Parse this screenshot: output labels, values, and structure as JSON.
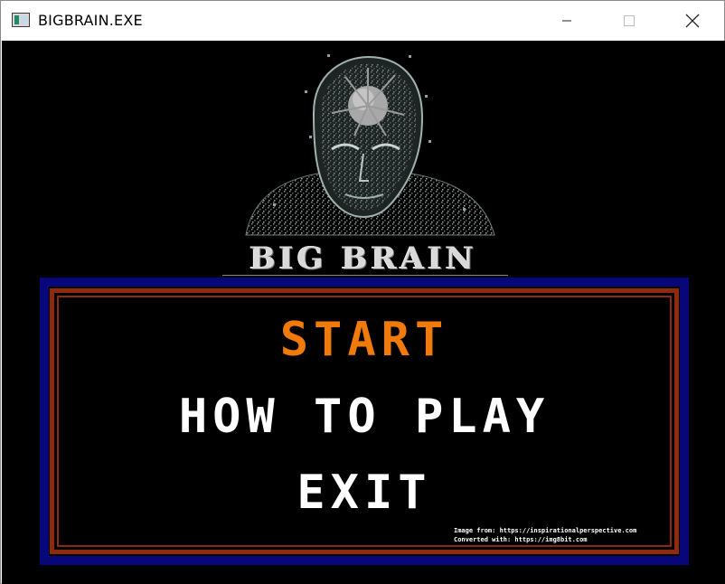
{
  "window": {
    "title": "BIGBRAIN.EXE",
    "app_icon": "app-window-icon",
    "controls": [
      "minimize-icon",
      "maximize-icon",
      "close-icon"
    ]
  },
  "game": {
    "background_color": "#000000",
    "logo_text": "BIG BRAIN",
    "menu": {
      "items": [
        {
          "label": "START",
          "selected": true,
          "color": "#f07a0a"
        },
        {
          "label": "HOW TO PLAY",
          "selected": false,
          "color": "#ffffff"
        },
        {
          "label": "EXIT",
          "selected": false,
          "color": "#ffffff"
        }
      ],
      "border_colors": {
        "outer": "#07077a",
        "inner": "#8e2a0d"
      }
    },
    "credits": [
      "Image from: https://inspirationalperspective.com",
      "Converted with: https://img8bit.com"
    ]
  }
}
